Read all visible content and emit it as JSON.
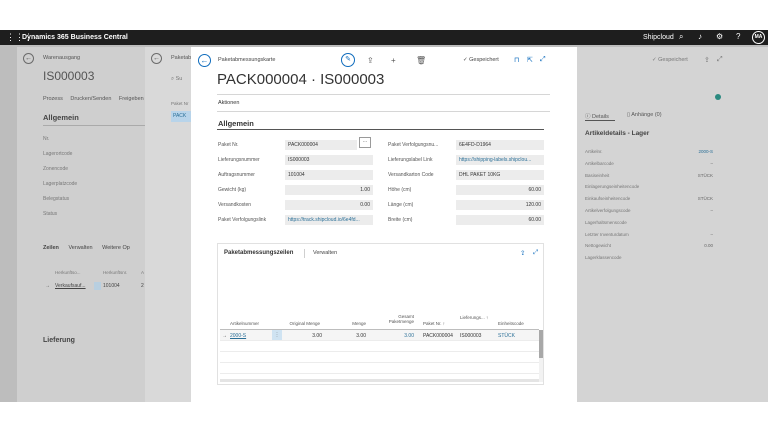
{
  "topbar": {
    "app_name": "Dynamics 365 Business Central",
    "company": "Shipcloud",
    "avatar_initials": "MA",
    "icons": [
      "waffle-icon",
      "search-icon",
      "bell-icon",
      "gear-icon",
      "help-icon"
    ]
  },
  "left_page": {
    "header": "Warenausgang",
    "number": "IS000003",
    "menu": [
      "Prozess",
      "Drucken/Senden",
      "Freigeben"
    ],
    "section_general": "Allgemein",
    "fields": [
      "Nr.",
      "Lagerortcode",
      "Zonencode",
      "Lagerplatzcode",
      "Belegstatus",
      "Status"
    ],
    "subtabs": [
      "Zeilen",
      "Verwalten",
      "Weitere Op"
    ],
    "col_a": "Herkunftso...",
    "col_b": "Herkunftsnr.",
    "col_c": "A",
    "row_link": "Verkaufsauf...",
    "row_value": "101004",
    "row_c": "2",
    "section_delivery": "Lieferung"
  },
  "middle_page": {
    "title": "Paketab",
    "search": "Su",
    "label": "Paket Nr",
    "value": "PACK"
  },
  "right_page": {
    "saved": "Gespeichert",
    "tab_details": "Details",
    "tab_attachments": "Anhänge (0)",
    "section_title": "Artikeldetails - Lager",
    "fields": [
      {
        "label": "Artikelnr.",
        "value": "2000-S",
        "link": true
      },
      {
        "label": "Artikelbarcode",
        "value": "–",
        "link": false
      },
      {
        "label": "Basiseinheit",
        "value": "STÜCK",
        "link": false
      },
      {
        "label": "Einlagerungseinheitencode",
        "value": "",
        "link": false
      },
      {
        "label": "Einkaufseinheitencode",
        "value": "STÜCK",
        "link": false
      },
      {
        "label": "Artikelverfolgungscode",
        "value": "–",
        "link": false
      },
      {
        "label": "Lagerhaltsmenscode",
        "value": "",
        "link": false
      },
      {
        "label": "Letzter Inventurdatum",
        "value": "–",
        "link": false
      },
      {
        "label": "Nettogewicht",
        "value": "0.00",
        "link": false
      },
      {
        "label": "Lagerklassencode",
        "value": "",
        "link": false
      }
    ]
  },
  "dialog": {
    "card_name": "Paketabmessungskarte",
    "title": "PACK000004 · IS000003",
    "saved": "Gespeichert",
    "actions_label": "Aktionen",
    "section_general": "Allgemein",
    "left_fields": [
      {
        "label": "Paket Nr.",
        "value": "PACK000004",
        "align": "left",
        "link": false
      },
      {
        "label": "Lieferungsnummer",
        "value": "IS000003",
        "align": "left",
        "link": false
      },
      {
        "label": "Auftragsnummer",
        "value": "101004",
        "align": "left",
        "link": false
      },
      {
        "label": "Gewicht (kg)",
        "value": "1.00",
        "align": "right",
        "link": false
      },
      {
        "label": "Versandkosten",
        "value": "0.00",
        "align": "right",
        "link": false
      },
      {
        "label": "Paket Verfolgungslink",
        "value": "https://track.shipcloud.io/6e4fd...",
        "align": "left",
        "link": true
      }
    ],
    "right_fields": [
      {
        "label": "Paket Verfolgungsnu...",
        "value": "6E4FD-D1964",
        "align": "left",
        "link": false
      },
      {
        "label": "Lieferungslabel Link",
        "value": "https://shipping-labels.shipclou...",
        "align": "left",
        "link": true
      },
      {
        "label": "Versandkarton Code",
        "value": "DHL PAKET 10KG",
        "align": "left",
        "link": false
      },
      {
        "label": "Höhe (cm)",
        "value": "60.00",
        "align": "right",
        "link": false
      },
      {
        "label": "Länge (cm)",
        "value": "120.00",
        "align": "right",
        "link": false
      },
      {
        "label": "Breite (cm)",
        "value": "60.00",
        "align": "right",
        "link": false
      }
    ],
    "lines": {
      "tab_lines": "Paketabmessungszeilen",
      "tab_manage": "Verwalten",
      "columns": {
        "item_no": "Artikelnummer",
        "orig_qty": "Original Menge",
        "qty": "Menge",
        "total_qty": "Gesamt Paketmenge",
        "pkg_no": "Paket Nr. ↑",
        "delivery": "Lieferungs... ↑",
        "unit": "Einheitscode"
      },
      "row": {
        "arrow": "→",
        "item_no": "2000-S",
        "orig_qty": "3.00",
        "qty": "3.00",
        "total_qty": "3.00",
        "pkg_no": "PACK000004",
        "delivery": "IS000003",
        "unit": "STÜCK"
      }
    }
  }
}
